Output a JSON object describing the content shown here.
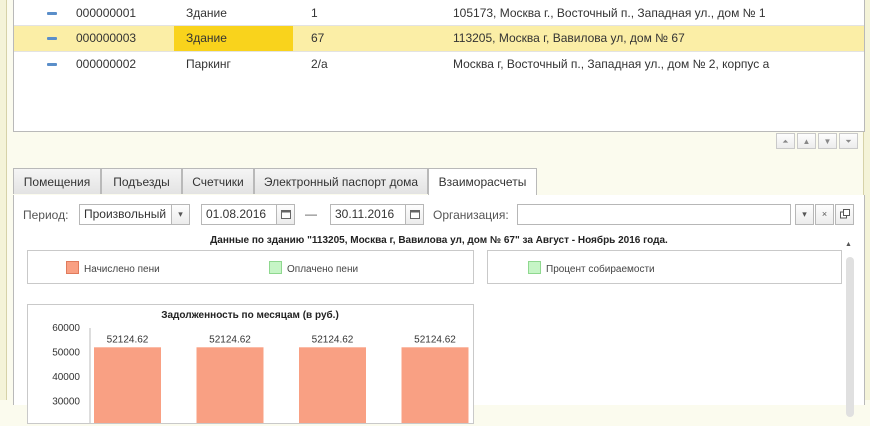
{
  "list": {
    "rows": [
      {
        "code": "000000001",
        "type": "Здание",
        "number": "1",
        "address": "105173, Москва г., Восточный п., Западная ул., дом № 1",
        "selected": false
      },
      {
        "code": "000000003",
        "type": "Здание",
        "number": "67",
        "address": "113205, Москва г, Вавилова ул, дом № 67",
        "selected": true
      },
      {
        "code": "000000002",
        "type": "Паркинг",
        "number": "2/а",
        "address": "Москва г, Восточный п., Западная ул., дом № 2, корпус а",
        "selected": false
      }
    ]
  },
  "sort_buttons": [
    {
      "name": "move-first",
      "icon": "move-first-icon",
      "glyph": "⏶"
    },
    {
      "name": "move-up",
      "icon": "move-up-icon",
      "glyph": "▲"
    },
    {
      "name": "move-down",
      "icon": "move-down-icon",
      "glyph": "▼"
    },
    {
      "name": "move-last",
      "icon": "move-last-icon",
      "glyph": "⏷"
    }
  ],
  "tabs": [
    {
      "label": "Помещения",
      "active": false
    },
    {
      "label": "Подъезды",
      "active": false
    },
    {
      "label": "Счетчики",
      "active": false
    },
    {
      "label": "Электронный паспорт дома",
      "active": false
    },
    {
      "label": "Взаиморасчеты",
      "active": true
    }
  ],
  "filters": {
    "period_label": "Период:",
    "period_value": "Произвольный",
    "date_from": "01.08.2016",
    "dash": "—",
    "date_to": "30.11.2016",
    "org_label": "Организация:",
    "org_value": ""
  },
  "report": {
    "title": "Данные по зданию \"113205, Москва г, Вавилова ул, дом № 67\" за Август - Ноябрь 2016 года.",
    "legend_left": [
      {
        "label": "Начислено пени",
        "color": "#f9a083"
      },
      {
        "label": "Оплачено пени",
        "color": "#c6f5c6"
      }
    ],
    "legend_right": [
      {
        "label": "Процент собираемости",
        "color": "#c6f5c6"
      }
    ]
  },
  "chart_data": {
    "type": "bar",
    "title": "Задолженность по месяцам (в руб.)",
    "categories": [
      "",
      "",
      "",
      ""
    ],
    "values": [
      52124.62,
      52124.62,
      52124.62,
      52124.62
    ],
    "data_labels": [
      "52124.62",
      "52124.62",
      "52124.62",
      "52124.62"
    ],
    "ylim": [
      0,
      60000
    ],
    "yticks": [
      "60000",
      "50000",
      "40000",
      "30000"
    ],
    "ytick_values": [
      60000,
      50000,
      40000,
      30000
    ],
    "bar_color": "#f9a083",
    "grid": false
  }
}
